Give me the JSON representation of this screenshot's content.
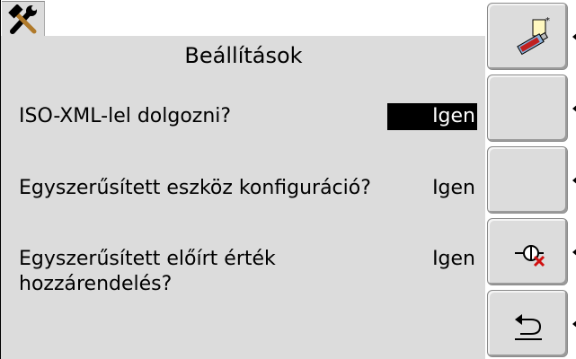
{
  "header": {
    "app_icon": "tools-icon",
    "title": "Beállítások"
  },
  "settings": [
    {
      "label": "ISO-XML-lel dolgozni?",
      "value": "Igen",
      "selected": true
    },
    {
      "label": "Egyszerűsített eszköz konfiguráció?",
      "value": "Igen",
      "selected": false
    },
    {
      "label_line1": "Egyszerűsített előírt érték",
      "label_line2": "hozzárendelés?",
      "value": "Igen",
      "selected": false
    }
  ],
  "softkeys": [
    {
      "icon": "new-document-usb-icon"
    },
    {
      "icon": ""
    },
    {
      "icon": ""
    },
    {
      "icon": "no-flow-cancel-icon"
    },
    {
      "icon": "return-arrow-icon"
    }
  ],
  "colors": {
    "background": "#dcdcdc",
    "selected_bg": "#000000",
    "selected_text": "#ffffff",
    "cancel_red": "#d01010"
  }
}
